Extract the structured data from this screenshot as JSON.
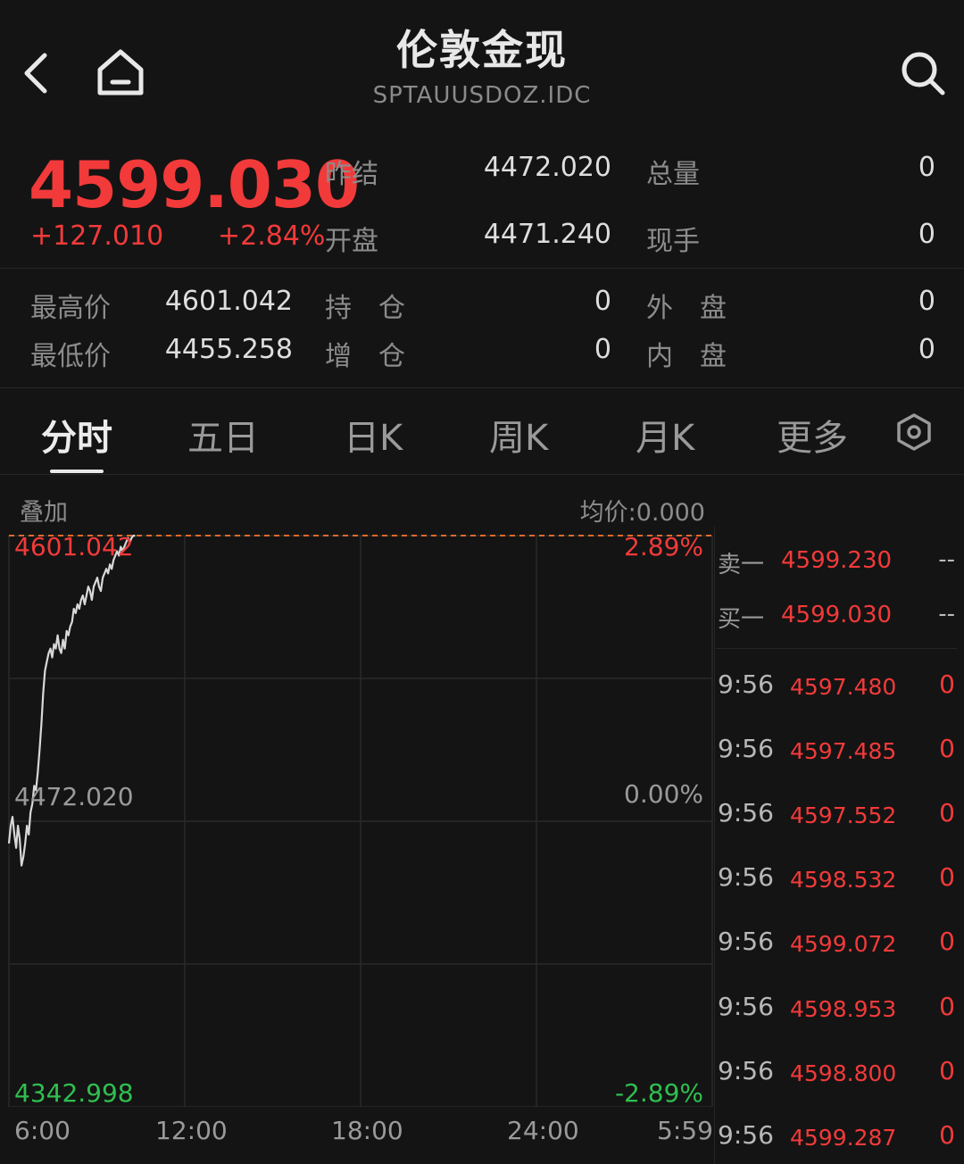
{
  "header": {
    "title": "伦敦金现",
    "code": "SPTAUUSDOZ.IDC"
  },
  "quote": {
    "price": "4599.030",
    "change": "+127.010",
    "change_pct": "+2.84%",
    "stats": {
      "prev_settle_label": "昨结",
      "prev_settle": "4472.020",
      "volume_label": "总量",
      "volume": "0",
      "open_label": "开盘",
      "open": "4471.240",
      "current_hand_label": "现手",
      "current_hand": "0",
      "high_label": "最高价",
      "high": "4601.042",
      "position_label": "持　仓",
      "position": "0",
      "outer_label": "外　盘",
      "outer": "0",
      "low_label": "最低价",
      "low": "4455.258",
      "increase_label": "增　仓",
      "increase": "0",
      "inner_label": "内　盘",
      "inner": "0"
    }
  },
  "tabs": [
    {
      "label": "分时",
      "active": true
    },
    {
      "label": "五日"
    },
    {
      "label": "日K"
    },
    {
      "label": "周K"
    },
    {
      "label": "月K"
    },
    {
      "label": "更多"
    }
  ],
  "chart": {
    "overlay_label": "叠加",
    "avg_label": "均价:0.000",
    "max_price": "4601.042",
    "mid_price": "4472.020",
    "min_price": "4342.998",
    "max_pct": "2.89%",
    "mid_pct": "0.00%",
    "min_pct": "-2.89%",
    "time_labels": [
      "6:00",
      "12:00",
      "18:00",
      "24:00",
      "5:59"
    ],
    "colors": {
      "up": "#f23a3a",
      "down": "#2fbf4f",
      "line": "#d8d8d8",
      "ref": "#e06a2a"
    }
  },
  "chart_data": {
    "type": "line",
    "title": "",
    "xlabel": "",
    "ylabel": "",
    "x_ticks": [
      "6:00",
      "12:00",
      "18:00",
      "24:00",
      "5:59"
    ],
    "ylim": [
      4342.998,
      4601.042
    ],
    "reference": 4472.02,
    "series": [
      {
        "x": [
          0,
          2,
          4,
          6,
          8,
          10,
          12,
          14,
          16,
          18,
          20,
          22,
          24,
          26,
          28,
          30,
          32,
          34,
          36,
          38,
          40,
          42,
          44,
          46,
          48,
          50,
          52,
          54,
          56,
          58,
          60,
          62,
          64,
          66,
          68,
          70,
          72,
          74,
          76,
          78,
          80,
          82,
          84,
          86,
          88,
          90,
          92,
          94,
          96,
          98,
          100,
          102,
          104,
          106,
          108,
          110,
          112,
          114,
          116,
          118,
          120,
          122,
          124,
          126,
          128,
          130,
          132,
          134,
          136,
          138,
          140
        ],
        "values": [
          4462,
          4470,
          4474,
          4466,
          4460,
          4470,
          4464,
          4452,
          4456,
          4462,
          4470,
          4466,
          4476,
          4480,
          4488,
          4486,
          4494,
          4504,
          4516,
          4530,
          4540,
          4544,
          4548,
          4550,
          4546,
          4552,
          4550,
          4556,
          4550,
          4548,
          4554,
          4550,
          4558,
          4556,
          4560,
          4562,
          4568,
          4566,
          4570,
          4568,
          4572,
          4574,
          4570,
          4574,
          4578,
          4576,
          4572,
          4578,
          4580,
          4582,
          4578,
          4576,
          4582,
          4584,
          4586,
          4584,
          4588,
          4586,
          4590,
          4592,
          4594,
          4592,
          4596,
          4594,
          4596,
          4598,
          4600,
          4598,
          4600,
          4601,
          4601
        ]
      }
    ]
  },
  "orderbook": [
    {
      "label": "卖一",
      "price": "4599.230",
      "vol": "--"
    },
    {
      "label": "买一",
      "price": "4599.030",
      "vol": "--"
    }
  ],
  "ticks": [
    {
      "time": "9:56",
      "price": "4597.480",
      "vol": "0"
    },
    {
      "time": "9:56",
      "price": "4597.485",
      "vol": "0"
    },
    {
      "time": "9:56",
      "price": "4597.552",
      "vol": "0"
    },
    {
      "time": "9:56",
      "price": "4598.532",
      "vol": "0"
    },
    {
      "time": "9:56",
      "price": "4599.072",
      "vol": "0"
    },
    {
      "time": "9:56",
      "price": "4598.953",
      "vol": "0"
    },
    {
      "time": "9:56",
      "price": "4598.800",
      "vol": "0"
    },
    {
      "time": "9:56",
      "price": "4599.287",
      "vol": "0"
    }
  ],
  "icons": {
    "back": "chevron-left-icon",
    "home": "home-icon",
    "search": "search-icon",
    "settings": "settings-hexagon-icon"
  }
}
